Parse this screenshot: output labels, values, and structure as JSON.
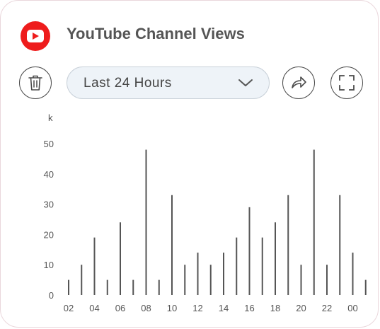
{
  "header": {
    "title": "YouTube Channel Views",
    "logo_icon": "youtube-logo-icon",
    "brand_color": "#ee1c1c"
  },
  "toolbar": {
    "delete_icon": "trash-icon",
    "range_select": {
      "selected": "Last 24 Hours",
      "icon": "chevron-down-icon"
    },
    "share_icon": "share-icon",
    "expand_icon": "expand-icon"
  },
  "chart_data": {
    "type": "bar",
    "ylabel": "k",
    "ylim": [
      0,
      50
    ],
    "y_ticks": [
      "0",
      "10",
      "20",
      "30",
      "40",
      "50"
    ],
    "x_tick_labels": [
      "02",
      "04",
      "06",
      "08",
      "10",
      "12",
      "14",
      "16",
      "18",
      "20",
      "22",
      "00"
    ],
    "categories": [
      "02",
      "03",
      "04",
      "05",
      "06",
      "07",
      "08",
      "09",
      "10",
      "11",
      "12",
      "13",
      "14",
      "15",
      "16",
      "17",
      "18",
      "19",
      "20",
      "21",
      "22",
      "23",
      "00",
      "01"
    ],
    "values": [
      5,
      10,
      19,
      5,
      24,
      5,
      48,
      5,
      33,
      10,
      14,
      10,
      14,
      19,
      29,
      19,
      24,
      33,
      10,
      48,
      10,
      33,
      14,
      5
    ],
    "bar_color": "#555555",
    "grid": false
  }
}
